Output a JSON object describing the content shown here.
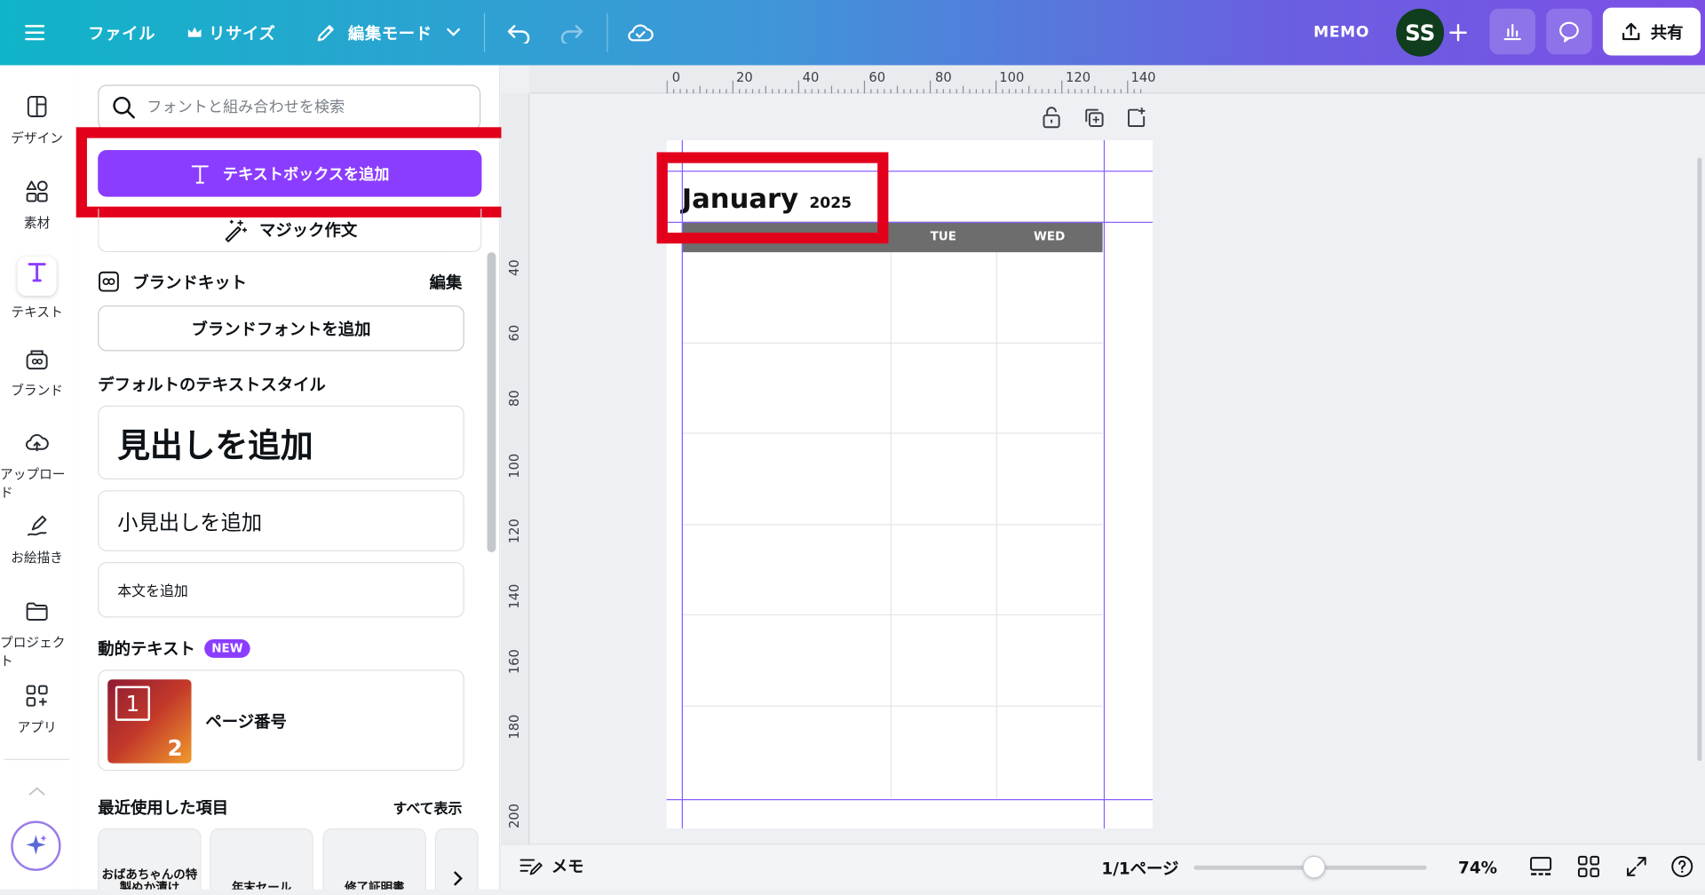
{
  "header": {
    "file_label": "ファイル",
    "resize_label": "リサイズ",
    "edit_mode_label": "編集モード",
    "memo_label": "MEMO",
    "avatar_initials": "SS",
    "share_label": "共有"
  },
  "rail": {
    "items": [
      {
        "label": "デザイン",
        "icon": "design-icon"
      },
      {
        "label": "素材",
        "icon": "elements-icon"
      },
      {
        "label": "テキスト",
        "icon": "text-icon"
      },
      {
        "label": "ブランド",
        "icon": "brand-icon"
      },
      {
        "label": "アップロード",
        "icon": "upload-icon"
      },
      {
        "label": "お絵描き",
        "icon": "draw-icon"
      },
      {
        "label": "プロジェクト",
        "icon": "folder-icon"
      },
      {
        "label": "アプリ",
        "icon": "apps-icon"
      }
    ]
  },
  "panel": {
    "search_placeholder": "フォントと組み合わせを検索",
    "add_textbox_label": "テキストボックスを追加",
    "magic_write_label": "マジック作文",
    "brand_kit_label": "ブランドキット",
    "brand_kit_edit": "編集",
    "add_brand_font_label": "ブランドフォントを追加",
    "default_styles_heading": "デフォルトのテキストスタイル",
    "heading_label": "見出しを追加",
    "subheading_label": "小見出しを追加",
    "body_label": "本文を追加",
    "dynamic_text_heading": "動的テキスト",
    "new_badge": "NEW",
    "page_number_label": "ページ番号",
    "page_number_thumb_1": "1",
    "page_number_thumb_2": "2",
    "recent_heading": "最近使用した項目",
    "show_all_label": "すべて表示",
    "recent_items": [
      "おばあちゃんの特製ぬか漬け",
      "年末セール",
      "修了証明書"
    ]
  },
  "rulers": {
    "horizontal": [
      "0",
      "20",
      "40",
      "60",
      "80",
      "100",
      "120",
      "140"
    ],
    "vertical": [
      "40",
      "60",
      "80",
      "100",
      "120",
      "140",
      "160",
      "180",
      "200"
    ]
  },
  "calendar": {
    "month": "January",
    "year": "2025",
    "days": [
      "TUE",
      "WED"
    ]
  },
  "footer": {
    "notes_label": "メモ",
    "page_indicator": "1/1ページ",
    "zoom": "74%",
    "zoom_level": 0.74
  },
  "colors": {
    "accent": "#8b3dff",
    "highlight": "#e2001b",
    "guide": "#8a5cff"
  }
}
